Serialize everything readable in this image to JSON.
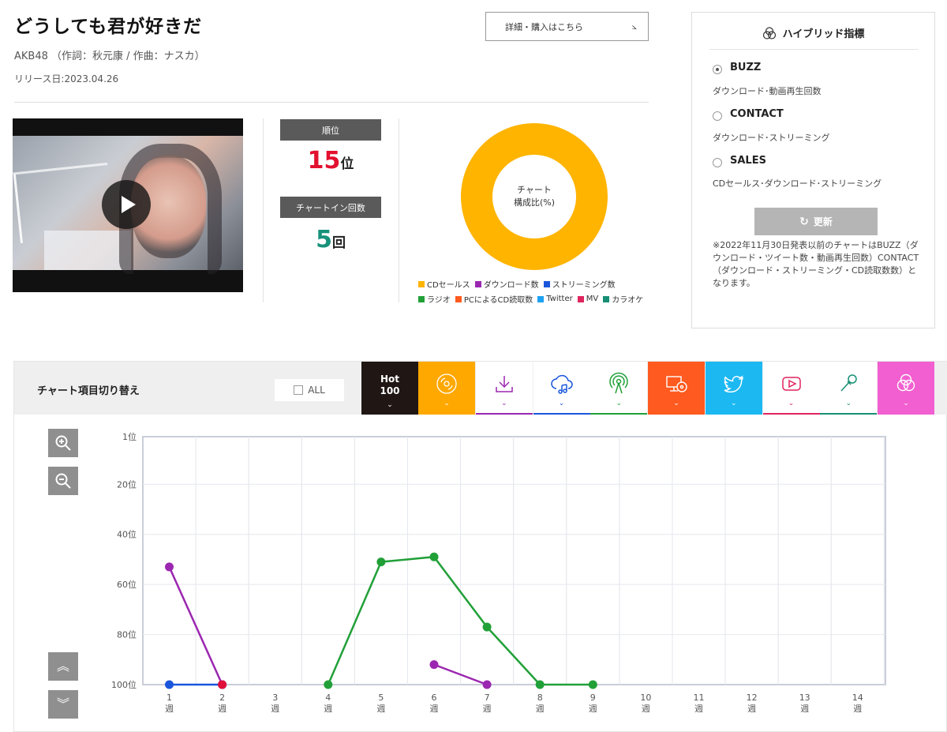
{
  "song": {
    "title": "どうしても君が好きだ",
    "artist_line": "AKB48 （作詞：秋元康 / 作曲：ナスカ）",
    "release": "リリース日:2023.04.26",
    "detail_button": "詳細・購入はこちら"
  },
  "rank": {
    "rank_label": "順位",
    "rank_value": "15",
    "rank_unit": "位",
    "chartin_label": "チャートイン回数",
    "chartin_value": "5",
    "chartin_unit": "回"
  },
  "donut": {
    "center_line1": "チャート",
    "center_line2": "構成比(%)",
    "color": "#ffb400",
    "legend_row1": [
      {
        "label": "CDセールス",
        "color": "#ffb400"
      },
      {
        "label": "ダウンロード数",
        "color": "#9b27b0"
      },
      {
        "label": "ストリーミング数",
        "color": "#1a56db"
      }
    ],
    "legend_row2": [
      {
        "label": "ラジオ",
        "color": "#21a038"
      },
      {
        "label": "PCによるCD読取数",
        "color": "#ff5a1f"
      },
      {
        "label": "Twitter",
        "color": "#1da1f2"
      },
      {
        "label": "MV",
        "color": "#e0245e"
      },
      {
        "label": "カラオケ",
        "color": "#178f74"
      }
    ]
  },
  "hybrid": {
    "title": "ハイブリッド指標",
    "options": [
      {
        "label": "BUZZ",
        "desc": "ダウンロード･動画再生回数",
        "selected": true
      },
      {
        "label": "CONTACT",
        "desc": "ダウンロード･ストリーミング",
        "selected": false
      },
      {
        "label": "SALES",
        "desc": "CDセールス･ダウンロード･ストリーミング",
        "selected": false
      }
    ],
    "refresh_label": "更新",
    "note": "※2022年11月30日発表以前のチャートはBUZZ（ダウンロード・ツイート数・動画再生回数）CONTACT（ダウンロード・ストリーミング・CD読取数数）となります。"
  },
  "chart_controls": {
    "switch_label": "チャート項目切り替え",
    "all_label": "ALL",
    "hot_line1": "Hot",
    "hot_line2": "100",
    "tabs": [
      {
        "icon": "cd-sales-icon",
        "bg": "#ffa800",
        "underline": "#ffa800",
        "color": "#ffffff"
      },
      {
        "icon": "download-icon",
        "bg": "#ffffff",
        "underline": "#9b27b0",
        "color": "#9b27b0"
      },
      {
        "icon": "streaming-icon",
        "bg": "#ffffff",
        "underline": "#1a56db",
        "color": "#1a56db"
      },
      {
        "icon": "radio-icon",
        "bg": "#ffffff",
        "underline": "#21a038",
        "color": "#21a038"
      },
      {
        "icon": "pc-cd-read-icon",
        "bg": "#ff5a1f",
        "underline": "#ff5a1f",
        "color": "#ffffff"
      },
      {
        "icon": "twitter-icon",
        "bg": "#1cb8f2",
        "underline": "#1cb8f2",
        "color": "#ffffff"
      },
      {
        "icon": "youtube-icon",
        "bg": "#ffffff",
        "underline": "#e0245e",
        "color": "#e0245e"
      },
      {
        "icon": "karaoke-icon",
        "bg": "#ffffff",
        "underline": "#178f74",
        "color": "#178f74"
      },
      {
        "icon": "hybrid-icon",
        "bg": "#f25fd0",
        "underline": "#f25fd0",
        "color": "#ffffff"
      }
    ]
  },
  "chart_data": {
    "type": "line",
    "x": [
      "1\n週",
      "2\n週",
      "3\n週",
      "4\n週",
      "5\n週",
      "6\n週",
      "7\n週",
      "8\n週",
      "9\n週",
      "10\n週",
      "11\n週",
      "12\n週",
      "13\n週",
      "14\n週"
    ],
    "y_ticks": [
      "1位",
      "20位",
      "40位",
      "60位",
      "80位",
      "100位"
    ],
    "y_tick_values": [
      1,
      20,
      40,
      60,
      80,
      100
    ],
    "ylim": [
      1,
      100
    ],
    "y_inverted": true,
    "grid": true,
    "series": [
      {
        "color": "#9b27b0",
        "points": [
          [
            1,
            53
          ],
          [
            2,
            100
          ]
        ]
      },
      {
        "color": "#9b27b0",
        "points": [
          [
            6,
            92
          ],
          [
            7,
            100
          ]
        ]
      },
      {
        "color": "#21a038",
        "points": [
          [
            4,
            100
          ],
          [
            5,
            51
          ],
          [
            6,
            49
          ],
          [
            7,
            77
          ],
          [
            8,
            100
          ],
          [
            9,
            100
          ]
        ]
      },
      {
        "color": "#1a56db",
        "points": [
          [
            1,
            100
          ],
          [
            2,
            100
          ]
        ]
      },
      {
        "color": "#e0103a",
        "points": [
          [
            2,
            100
          ]
        ]
      }
    ]
  }
}
